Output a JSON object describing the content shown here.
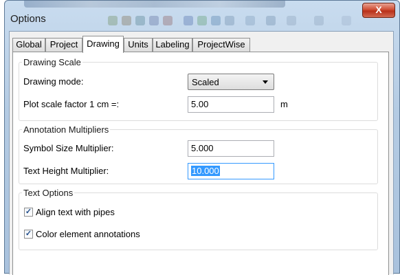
{
  "window": {
    "title": "Options",
    "close_symbol": "X"
  },
  "tabs": [
    {
      "label": "Global",
      "active": false
    },
    {
      "label": "Project",
      "active": false
    },
    {
      "label": "Drawing",
      "active": true
    },
    {
      "label": "Units",
      "active": false
    },
    {
      "label": "Labeling",
      "active": false
    },
    {
      "label": "ProjectWise",
      "active": false
    }
  ],
  "drawing_scale": {
    "title": "Drawing Scale",
    "mode_label": "Drawing mode:",
    "mode_value": "Scaled",
    "plot_label": "Plot scale factor  1 cm =:",
    "plot_value": "5.00",
    "plot_unit": "m"
  },
  "annotation": {
    "title": "Annotation Multipliers",
    "symbol_label": "Symbol Size Multiplier:",
    "symbol_value": "5.000",
    "text_label": "Text Height Multiplier:",
    "text_value": "10.000"
  },
  "text_options": {
    "title": "Text Options",
    "align_label": "Align text with pipes",
    "align_checked": true,
    "color_label": "Color element annotations",
    "color_checked": true
  },
  "colors": {
    "accent": "#3399ff",
    "close_button": "#c9442c",
    "title_bar": "#b4cbe3"
  }
}
